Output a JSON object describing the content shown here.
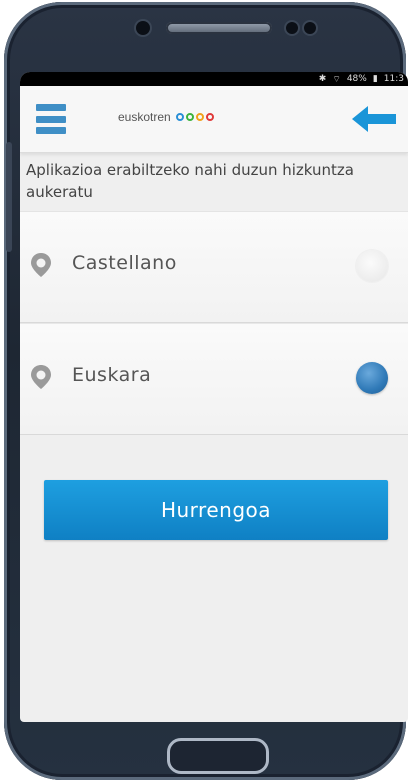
{
  "status_bar": {
    "time": "11:3",
    "battery": "48%"
  },
  "app_bar": {
    "brand_name": "euskotren",
    "menu_icon": "hamburger-menu-icon",
    "back_icon": "arrow-left-icon",
    "brand_dot_colors": [
      "#2a8fd6",
      "#3db33d",
      "#f2a21c",
      "#e03a3a"
    ]
  },
  "main": {
    "instruction": "Aplikazioa erabiltzeko nahi duzun hizkuntza aukeratu",
    "languages": [
      {
        "label": "Castellano",
        "selected": false,
        "icon": "location-pin-icon"
      },
      {
        "label": "Euskara",
        "selected": true,
        "icon": "location-pin-icon"
      }
    ],
    "next_button_label": "Hurrengoa"
  },
  "colors": {
    "accent": "#1a95d8",
    "menu_blue": "#3f8fc6"
  }
}
